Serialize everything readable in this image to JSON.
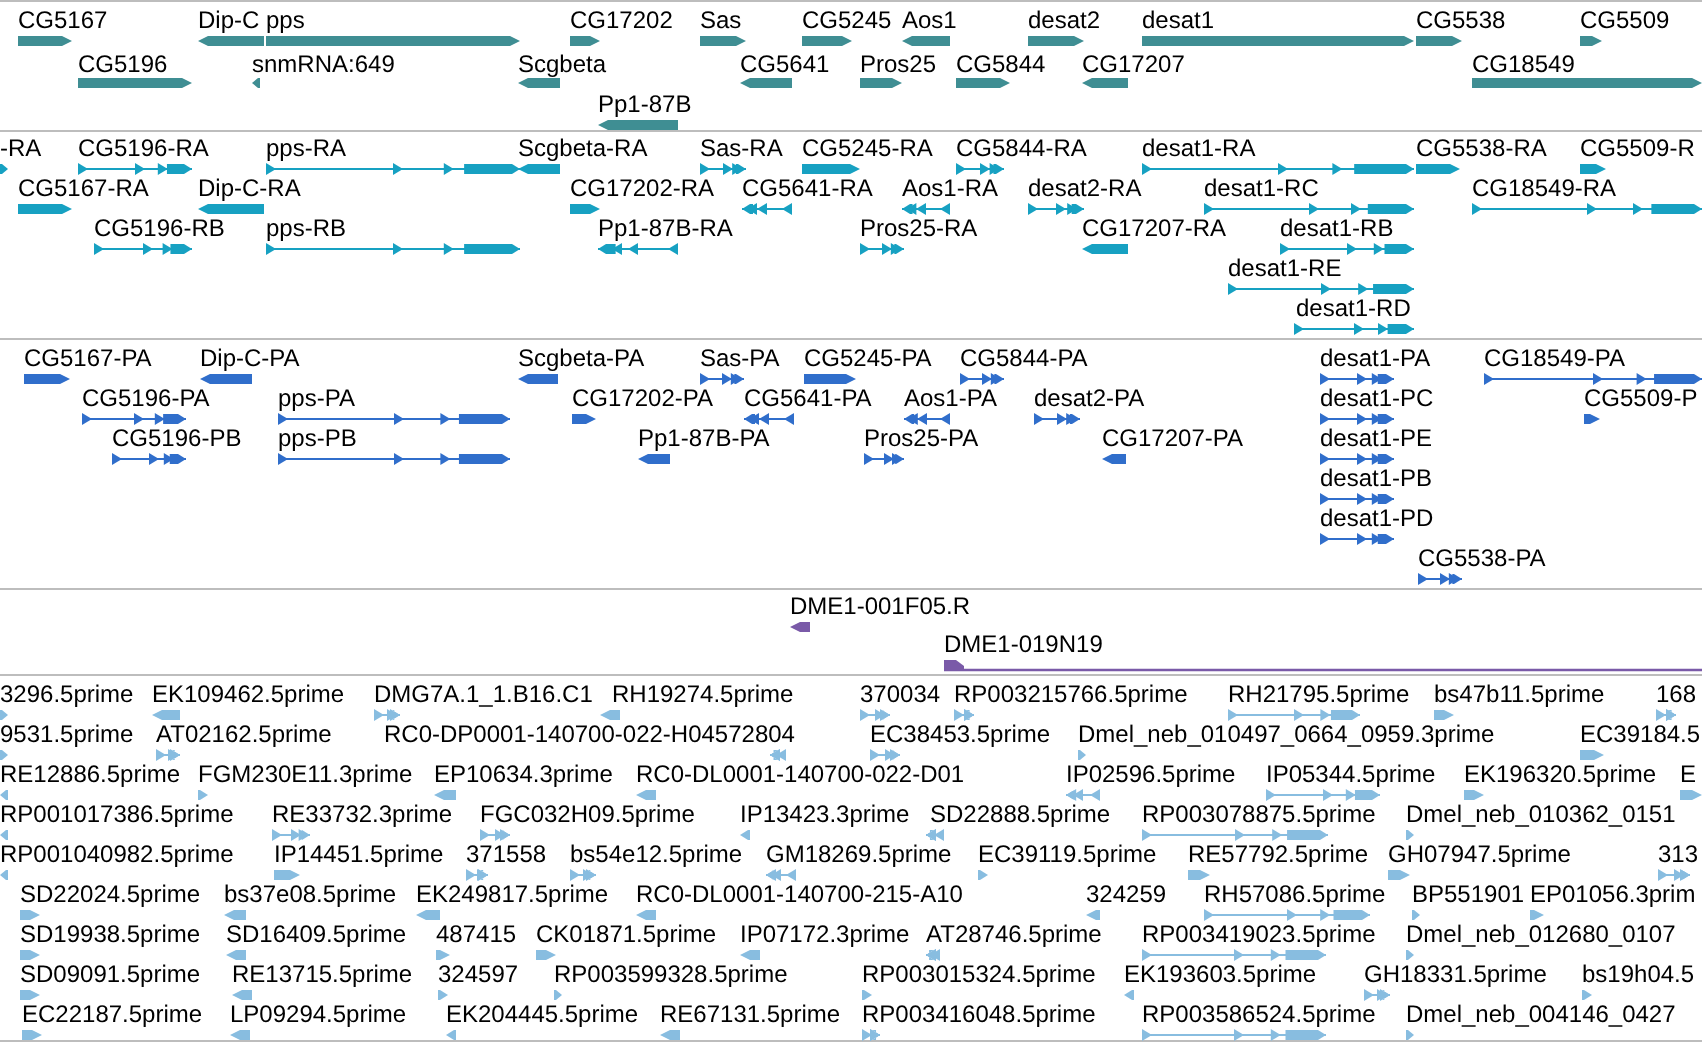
{
  "tracks": [
    {
      "kind": "gene",
      "features": [
        {
          "label": "CG5167",
          "reverse": false
        },
        {
          "label": "Dip-C",
          "reverse": true
        },
        {
          "label": "pps",
          "reverse": false
        },
        {
          "label": "CG17202",
          "reverse": false
        },
        {
          "label": "Sas",
          "reverse": false
        },
        {
          "label": "CG5245",
          "reverse": false
        },
        {
          "label": "Aos1",
          "reverse": true
        },
        {
          "label": "desat2",
          "reverse": false
        },
        {
          "label": "desat1",
          "reverse": false
        },
        {
          "label": "CG5538",
          "reverse": false
        },
        {
          "label": "CG5509",
          "reverse": false
        },
        {
          "label": "CG5196",
          "reverse": false
        },
        {
          "label": "snmRNA:649",
          "reverse": true
        },
        {
          "label": "Scgbeta",
          "reverse": true
        },
        {
          "label": "CG5641",
          "reverse": true
        },
        {
          "label": "Pros25",
          "reverse": false
        },
        {
          "label": "CG5844",
          "reverse": false
        },
        {
          "label": "CG17207",
          "reverse": true
        },
        {
          "label": "CG18549",
          "reverse": false
        },
        {
          "label": "Pp1-87B",
          "reverse": true
        }
      ]
    },
    {
      "kind": "transcript",
      "features": [
        {
          "label": "-RA",
          "reverse": false
        },
        {
          "label": "CG5196-RA",
          "reverse": false
        },
        {
          "label": "pps-RA",
          "reverse": false
        },
        {
          "label": "Scgbeta-RA",
          "reverse": true
        },
        {
          "label": "Sas-RA",
          "reverse": false
        },
        {
          "label": "CG5245-RA",
          "reverse": false
        },
        {
          "label": "CG5844-RA",
          "reverse": false
        },
        {
          "label": "desat1-RA",
          "reverse": false
        },
        {
          "label": "CG5538-RA",
          "reverse": false
        },
        {
          "label": "CG5509-R",
          "reverse": false
        },
        {
          "label": "CG5167-RA",
          "reverse": false
        },
        {
          "label": "Dip-C-RA",
          "reverse": true
        },
        {
          "label": "CG17202-RA",
          "reverse": false
        },
        {
          "label": "CG5641-RA",
          "reverse": true
        },
        {
          "label": "Aos1-RA",
          "reverse": true
        },
        {
          "label": "desat2-RA",
          "reverse": false
        },
        {
          "label": "desat1-RC",
          "reverse": false
        },
        {
          "label": "CG18549-RA",
          "reverse": false
        },
        {
          "label": "CG5196-RB",
          "reverse": false
        },
        {
          "label": "pps-RB",
          "reverse": false
        },
        {
          "label": "Pp1-87B-RA",
          "reverse": true
        },
        {
          "label": "Pros25-RA",
          "reverse": false
        },
        {
          "label": "CG17207-RA",
          "reverse": true
        },
        {
          "label": "desat1-RB",
          "reverse": false
        },
        {
          "label": "desat1-RE",
          "reverse": false
        },
        {
          "label": "desat1-RD",
          "reverse": false
        }
      ]
    },
    {
      "kind": "protein",
      "features": [
        {
          "label": "CG5167-PA",
          "reverse": false
        },
        {
          "label": "Dip-C-PA",
          "reverse": true
        },
        {
          "label": "Scgbeta-PA",
          "reverse": true
        },
        {
          "label": "Sas-PA",
          "reverse": false
        },
        {
          "label": "CG5245-PA",
          "reverse": false
        },
        {
          "label": "CG5844-PA",
          "reverse": false
        },
        {
          "label": "desat1-PA",
          "reverse": false
        },
        {
          "label": "CG18549-PA",
          "reverse": false
        },
        {
          "label": "CG5196-PA",
          "reverse": false
        },
        {
          "label": "pps-PA",
          "reverse": false
        },
        {
          "label": "CG17202-PA",
          "reverse": false
        },
        {
          "label": "CG5641-PA",
          "reverse": true
        },
        {
          "label": "Aos1-PA",
          "reverse": true
        },
        {
          "label": "desat2-PA",
          "reverse": false
        },
        {
          "label": "desat1-PC",
          "reverse": false
        },
        {
          "label": "CG5509-P",
          "reverse": false
        },
        {
          "label": "CG5196-PB",
          "reverse": false
        },
        {
          "label": "pps-PB",
          "reverse": false
        },
        {
          "label": "Pp1-87B-PA",
          "reverse": true
        },
        {
          "label": "Pros25-PA",
          "reverse": false
        },
        {
          "label": "CG17207-PA",
          "reverse": true
        },
        {
          "label": "desat1-PE",
          "reverse": false
        },
        {
          "label": "desat1-PB",
          "reverse": false
        },
        {
          "label": "desat1-PD",
          "reverse": false
        },
        {
          "label": "CG5538-PA",
          "reverse": false
        }
      ]
    },
    {
      "kind": "clone",
      "features": [
        {
          "label": "DME1-001F05.R",
          "reverse": true
        },
        {
          "label": "DME1-019N19",
          "reverse": false
        }
      ]
    },
    {
      "kind": "est",
      "features": [
        {
          "label": "3296.5prime",
          "reverse": false
        },
        {
          "label": "EK109462.5prime",
          "reverse": true
        },
        {
          "label": "DMG7A.1_1.B16.C1",
          "reverse": false
        },
        {
          "label": "RH19274.5prime",
          "reverse": true
        },
        {
          "label": "370034",
          "reverse": false
        },
        {
          "label": "RP003215766.5prime",
          "reverse": false
        },
        {
          "label": "RH21795.5prime",
          "reverse": false
        },
        {
          "label": "bs47b11.5prime",
          "reverse": false
        },
        {
          "label": "168",
          "reverse": false
        },
        {
          "label": "9531.5prime",
          "reverse": false
        },
        {
          "label": "AT02162.5prime",
          "reverse": false
        },
        {
          "label": "RC0-DP0001-140700-022-H04572804",
          "reverse": true
        },
        {
          "label": "EC38453.5prime",
          "reverse": false
        },
        {
          "label": "Dmel_neb_010497_0664_0959.3prime",
          "reverse": false
        },
        {
          "label": "EC39184.5",
          "reverse": false
        },
        {
          "label": "RE12886.5prime",
          "reverse": true
        },
        {
          "label": "FGM230E11.3prime",
          "reverse": false
        },
        {
          "label": "EP10634.3prime",
          "reverse": true
        },
        {
          "label": "RC0-DL0001-140700-022-D01",
          "reverse": true
        },
        {
          "label": "IP02596.5prime",
          "reverse": true
        },
        {
          "label": "IP05344.5prime",
          "reverse": false
        },
        {
          "label": "EK196320.5prime",
          "reverse": false
        },
        {
          "label": "E",
          "reverse": false
        },
        {
          "label": "RP001017386.5prime",
          "reverse": true
        },
        {
          "label": "RE33732.3prime",
          "reverse": false
        },
        {
          "label": "FGC032H09.5prime",
          "reverse": false
        },
        {
          "label": "IP13423.3prime",
          "reverse": true
        },
        {
          "label": "SD22888.5prime",
          "reverse": true
        },
        {
          "label": "RP003078875.5prime",
          "reverse": false
        },
        {
          "label": "Dmel_neb_010362_0151",
          "reverse": false
        },
        {
          "label": "RP001040982.5prime",
          "reverse": true
        },
        {
          "label": "IP14451.5prime",
          "reverse": false
        },
        {
          "label": "371558",
          "reverse": false
        },
        {
          "label": "bs54e12.5prime",
          "reverse": false
        },
        {
          "label": "GM18269.5prime",
          "reverse": true
        },
        {
          "label": "EC39119.5prime",
          "reverse": false
        },
        {
          "label": "RE57792.5prime",
          "reverse": false
        },
        {
          "label": "GH07947.5prime",
          "reverse": false
        },
        {
          "label": "313",
          "reverse": false
        },
        {
          "label": "SD22024.5prime",
          "reverse": false
        },
        {
          "label": "bs37e08.5prime",
          "reverse": true
        },
        {
          "label": "EK249817.5prime",
          "reverse": true
        },
        {
          "label": "RC0-DL0001-140700-215-A10",
          "reverse": true
        },
        {
          "label": "324259",
          "reverse": true
        },
        {
          "label": "RH57086.5prime",
          "reverse": false
        },
        {
          "label": "BP551901",
          "reverse": false
        },
        {
          "label": "EP01056.3prim",
          "reverse": false
        },
        {
          "label": "SD19938.5prime",
          "reverse": false
        },
        {
          "label": "SD16409.5prime",
          "reverse": true
        },
        {
          "label": "487415",
          "reverse": false
        },
        {
          "label": "CK01871.5prime",
          "reverse": false
        },
        {
          "label": "IP07172.3prime",
          "reverse": true
        },
        {
          "label": "AT28746.5prime",
          "reverse": true
        },
        {
          "label": "RP003419023.5prime",
          "reverse": false
        },
        {
          "label": "Dmel_neb_012680_0107",
          "reverse": false
        },
        {
          "label": "SD09091.5prime",
          "reverse": false
        },
        {
          "label": "RE13715.5prime",
          "reverse": true
        },
        {
          "label": "324597",
          "reverse": false
        },
        {
          "label": "RP003599328.5prime",
          "reverse": false
        },
        {
          "label": "RP003015324.5prime",
          "reverse": false
        },
        {
          "label": "EK193603.5prime",
          "reverse": true
        },
        {
          "label": "GH18331.5prime",
          "reverse": false
        },
        {
          "label": "bs19h04.5",
          "reverse": false
        },
        {
          "label": "EC22187.5prime",
          "reverse": false
        },
        {
          "label": "LP09294.5prime",
          "reverse": true
        },
        {
          "label": "EK204445.5prime",
          "reverse": true
        },
        {
          "label": "RE67131.5prime",
          "reverse": true
        },
        {
          "label": "RP003416048.5prime",
          "reverse": false
        },
        {
          "label": "RP003586524.5prime",
          "reverse": false
        },
        {
          "label": "Dmel_neb_004146_0427",
          "reverse": false
        }
      ]
    }
  ]
}
